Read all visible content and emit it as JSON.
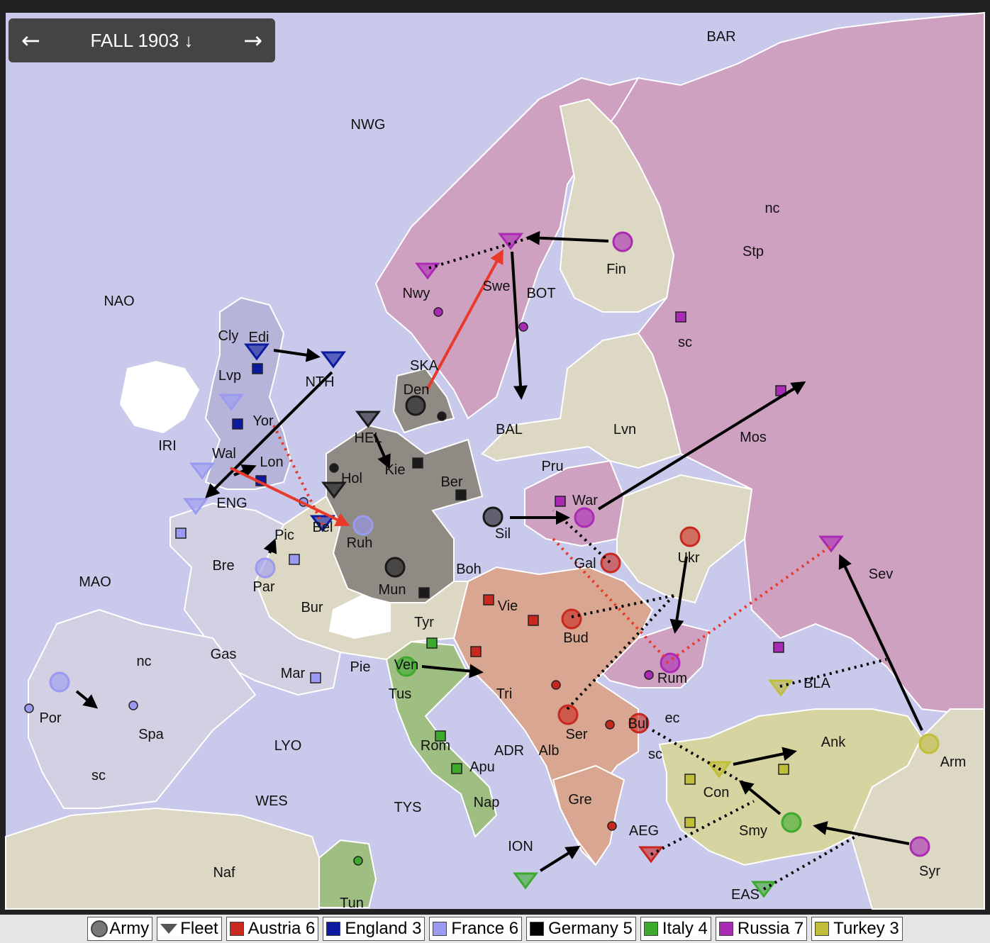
{
  "nav": {
    "title": "FALL 1903 ↓",
    "prev": "←",
    "next": "→"
  },
  "colors": {
    "sea": "#c9c9ec",
    "neutral": "#dcd8c3",
    "austria": "#d9a691",
    "england": "#b7b4d9",
    "france": "#d2d0e2",
    "germany": "#8f8b84",
    "italy": "#9fbf82",
    "russia": "#cfa1c1",
    "turkey": "#d6d4a0"
  },
  "legend": [
    {
      "key": "army",
      "label": "Army"
    },
    {
      "key": "fleet",
      "label": "Fleet"
    },
    {
      "key": "austria",
      "label": "Austria 6",
      "color": "#c8281e"
    },
    {
      "key": "england",
      "label": "England 3",
      "color": "#0b1a9e"
    },
    {
      "key": "france",
      "label": "France 6",
      "color": "#9a9af0"
    },
    {
      "key": "germany",
      "label": "Germany 5",
      "color": "#000000"
    },
    {
      "key": "italy",
      "label": "Italy 4",
      "color": "#3daa2e"
    },
    {
      "key": "russia",
      "label": "Russia 7",
      "color": "#aa2ab4"
    },
    {
      "key": "turkey",
      "label": "Turkey 3",
      "color": "#c0bd38"
    }
  ],
  "labels": [
    "BAR",
    "NWG",
    "nc",
    "Stp",
    "Fin",
    "Nwy",
    "Swe",
    "BOT",
    "NAO",
    "sc",
    "Cly",
    "Edi",
    "NTH",
    "SKA",
    "Den",
    "Lvp",
    "Yor",
    "HEL",
    "Kie",
    "BAL",
    "Lvn",
    "Mos",
    "IRI",
    "Wal",
    "Lon",
    "Hol",
    "Ber",
    "Pru",
    "ENG",
    "Bel",
    "Ruh",
    "Sil",
    "War",
    "Pic",
    "Gal",
    "Ukr",
    "Sev",
    "Bre",
    "Par",
    "Mun",
    "Boh",
    "MAO",
    "Vie",
    "Bur",
    "Tyr",
    "Bud",
    "nc",
    "Gas",
    "Mar",
    "Pie",
    "Ven",
    "Tri",
    "Rum",
    "BLA",
    "Por",
    "Spa",
    "Tus",
    "LYO",
    "Ser",
    "Bul",
    "ec",
    "Ank",
    "Arm",
    "sc",
    "Rom",
    "ADR",
    "Alb",
    "Apu",
    "sc",
    "Con",
    "WES",
    "TYS",
    "Nap",
    "Gre",
    "AEG",
    "Smy",
    "ION",
    "Naf",
    "Syr",
    "EAS",
    "Tun"
  ]
}
